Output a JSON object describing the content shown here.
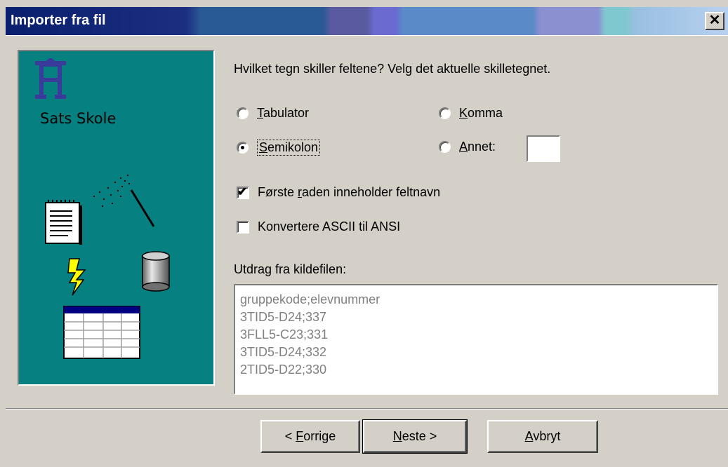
{
  "window": {
    "title": "Importer fra fil",
    "close_glyph": "✕"
  },
  "left_panel": {
    "brand": "Sats Skole",
    "logo_icon": "sats-skole-logo",
    "panel_color": "#068080"
  },
  "question": "Hvilket tegn skiller feltene? Velg det aktuelle skilletegnet.",
  "delimiters": {
    "tabulator": {
      "prefix": "",
      "mnemonic": "T",
      "rest": "abulator",
      "selected": false
    },
    "komma": {
      "prefix": "",
      "mnemonic": "K",
      "rest": "omma",
      "selected": false
    },
    "semikolon": {
      "prefix": "",
      "mnemonic": "S",
      "rest": "emikolon",
      "selected": true
    },
    "annet": {
      "prefix": "",
      "mnemonic": "A",
      "rest": "nnet:",
      "selected": false,
      "value": ""
    }
  },
  "options": {
    "first_row": {
      "prefix": "Første ",
      "mnemonic": "r",
      "rest": "aden inneholder feltnavn",
      "checked": true
    },
    "ascii": {
      "label": "Konvertere ASCII til ANSI",
      "checked": false
    }
  },
  "excerpt": {
    "label": "Utdrag fra kildefilen:",
    "lines": [
      "gruppekode;elevnummer",
      "3TID5-D24;337",
      "3FLL5-C23;331",
      "3TID5-D24;332",
      "2TID5-D22;330"
    ]
  },
  "buttons": {
    "back": {
      "prefix": "< ",
      "mnemonic": "F",
      "rest": "orrige"
    },
    "next": {
      "prefix": "",
      "mnemonic": "N",
      "rest": "este >"
    },
    "cancel": {
      "prefix": "",
      "mnemonic": "A",
      "rest": "vbryt"
    }
  }
}
